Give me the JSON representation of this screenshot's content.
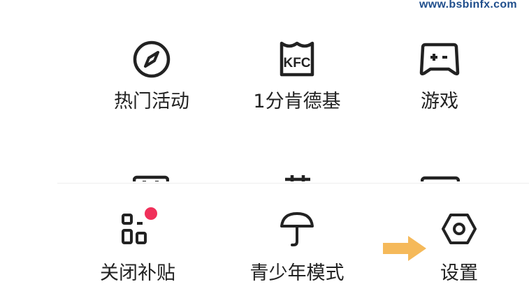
{
  "watermark": "www.bsbinfx.com",
  "grid": {
    "items": [
      {
        "label": "热门活动",
        "icon": "compass-icon"
      },
      {
        "label": "1分肯德基",
        "icon": "kfc-bucket-icon"
      },
      {
        "label": "游戏",
        "icon": "gamepad-icon"
      }
    ]
  },
  "bottom_bar": {
    "items": [
      {
        "label": "关闭补贴",
        "icon": "scan-code-icon",
        "badge": true
      },
      {
        "label": "青少年模式",
        "icon": "umbrella-icon"
      },
      {
        "label": "设置",
        "icon": "hexagon-settings-icon"
      }
    ]
  },
  "colors": {
    "badge": "#f0305a",
    "arrow": "#f5b95a",
    "watermark": "#1f4e8c",
    "icon": "#222222"
  }
}
